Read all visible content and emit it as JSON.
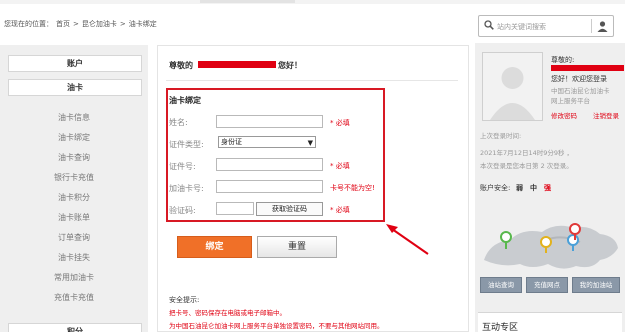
{
  "breadcrumb": {
    "prefix": "您现在的位置：",
    "items": [
      "首页",
      ">",
      "昆仑加油卡",
      ">",
      "油卡绑定"
    ]
  },
  "search": {
    "placeholder": "站内关键词搜索",
    "icon": "search-icon",
    "user_icon": "user-icon"
  },
  "sidebar": {
    "top_button": "账户",
    "section_button": "油卡",
    "items": [
      "油卡信息",
      "油卡绑定",
      "油卡查询",
      "银行卡充值",
      "油卡积分",
      "油卡账单",
      "订单查询",
      "油卡挂失",
      "常用加油卡",
      "充值卡充值"
    ],
    "bottom_button": "积分"
  },
  "main": {
    "greeting_prefix": "尊敬的",
    "greeting_suffix": "您好！",
    "form_title": "油卡绑定",
    "fields": {
      "name_label": "姓名:",
      "name_required": "* 必填",
      "id_type_label": "证件类型:",
      "id_type_value": "身份证",
      "id_number_label": "证件号:",
      "id_number_required": "* 必填",
      "card_label": "加油卡号:",
      "card_hint": "卡号不能为空!",
      "code_label": "验证码:",
      "code_button": "获取验证码",
      "code_required": "* 必填"
    },
    "bind_button": "绑定",
    "reset_button": "重置",
    "tips_title": "安全提示:",
    "tips": [
      "把卡号、密码保存在电脑或电子邮箱中。",
      "为中国石油昆仑加油卡网上服务平台单独设置密码，不要与其他网站同用。"
    ]
  },
  "profile": {
    "salutation": "尊敬的:",
    "welcome": "您好！欢迎您登录",
    "platform": [
      "中国石油昆仑加油卡",
      "网上服务平台"
    ],
    "change_password": "修改密码",
    "logout": "注销登录",
    "last_login_label": "上次登录时间:",
    "last_login_time": "2021年7月12日14时9分9秒 ，",
    "login_count": "本次登录是您本日第 2 次登录。",
    "security_label": "账户安全:",
    "security_levels": [
      "弱",
      "中",
      "强"
    ],
    "buttons": [
      "油站查询",
      "充值网点",
      "我的加油站"
    ],
    "interactive_zone": "互动专区"
  },
  "colors": {
    "accent_red": "#e00012",
    "bind_orange": "#f07028",
    "panel_gray": "#efefef"
  }
}
